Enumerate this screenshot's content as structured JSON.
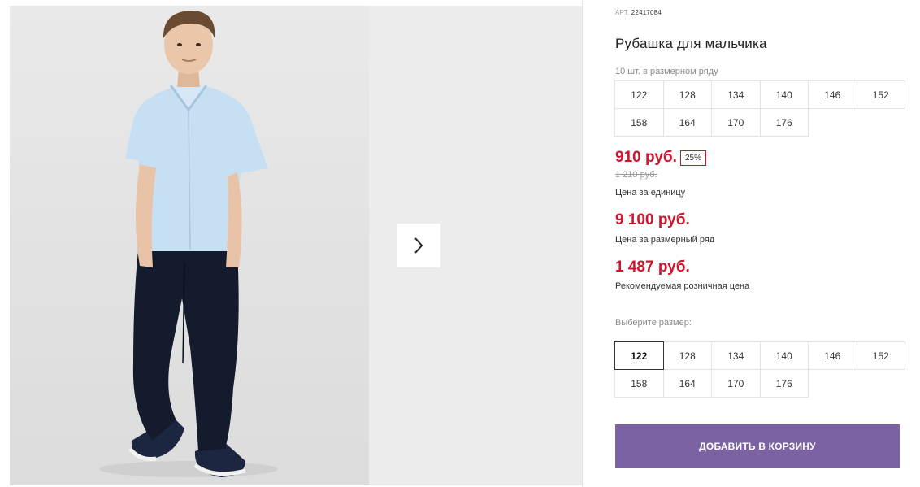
{
  "gallery": {
    "next_icon": "chevron-right-icon"
  },
  "product": {
    "sku_label": "АРТ.",
    "sku_value": "22417084",
    "title": "Рубашка для мальчика",
    "row_note": "10 шт. в размерном ряду",
    "row_sizes": [
      "122",
      "128",
      "134",
      "140",
      "146",
      "152",
      "158",
      "164",
      "170",
      "176"
    ],
    "price": "910 руб.",
    "discount": "25%",
    "old_price": "1 210 руб.",
    "price_caption": "Цена за единицу",
    "row_price": "9 100 руб.",
    "row_price_caption": "Цена за размерный ряд",
    "rrp": "1 487 руб.",
    "rrp_caption": "Рекомендуемая розничная цена",
    "choose_size_label": "Выберите размер:",
    "size_options": [
      "122",
      "128",
      "134",
      "140",
      "146",
      "152",
      "158",
      "164",
      "170",
      "176"
    ],
    "selected_size": "122",
    "add_to_cart": "ДОБАВИТЬ В КОРЗИНУ"
  },
  "colors": {
    "accent_price": "#d0142c",
    "button": "#7b62a3"
  }
}
